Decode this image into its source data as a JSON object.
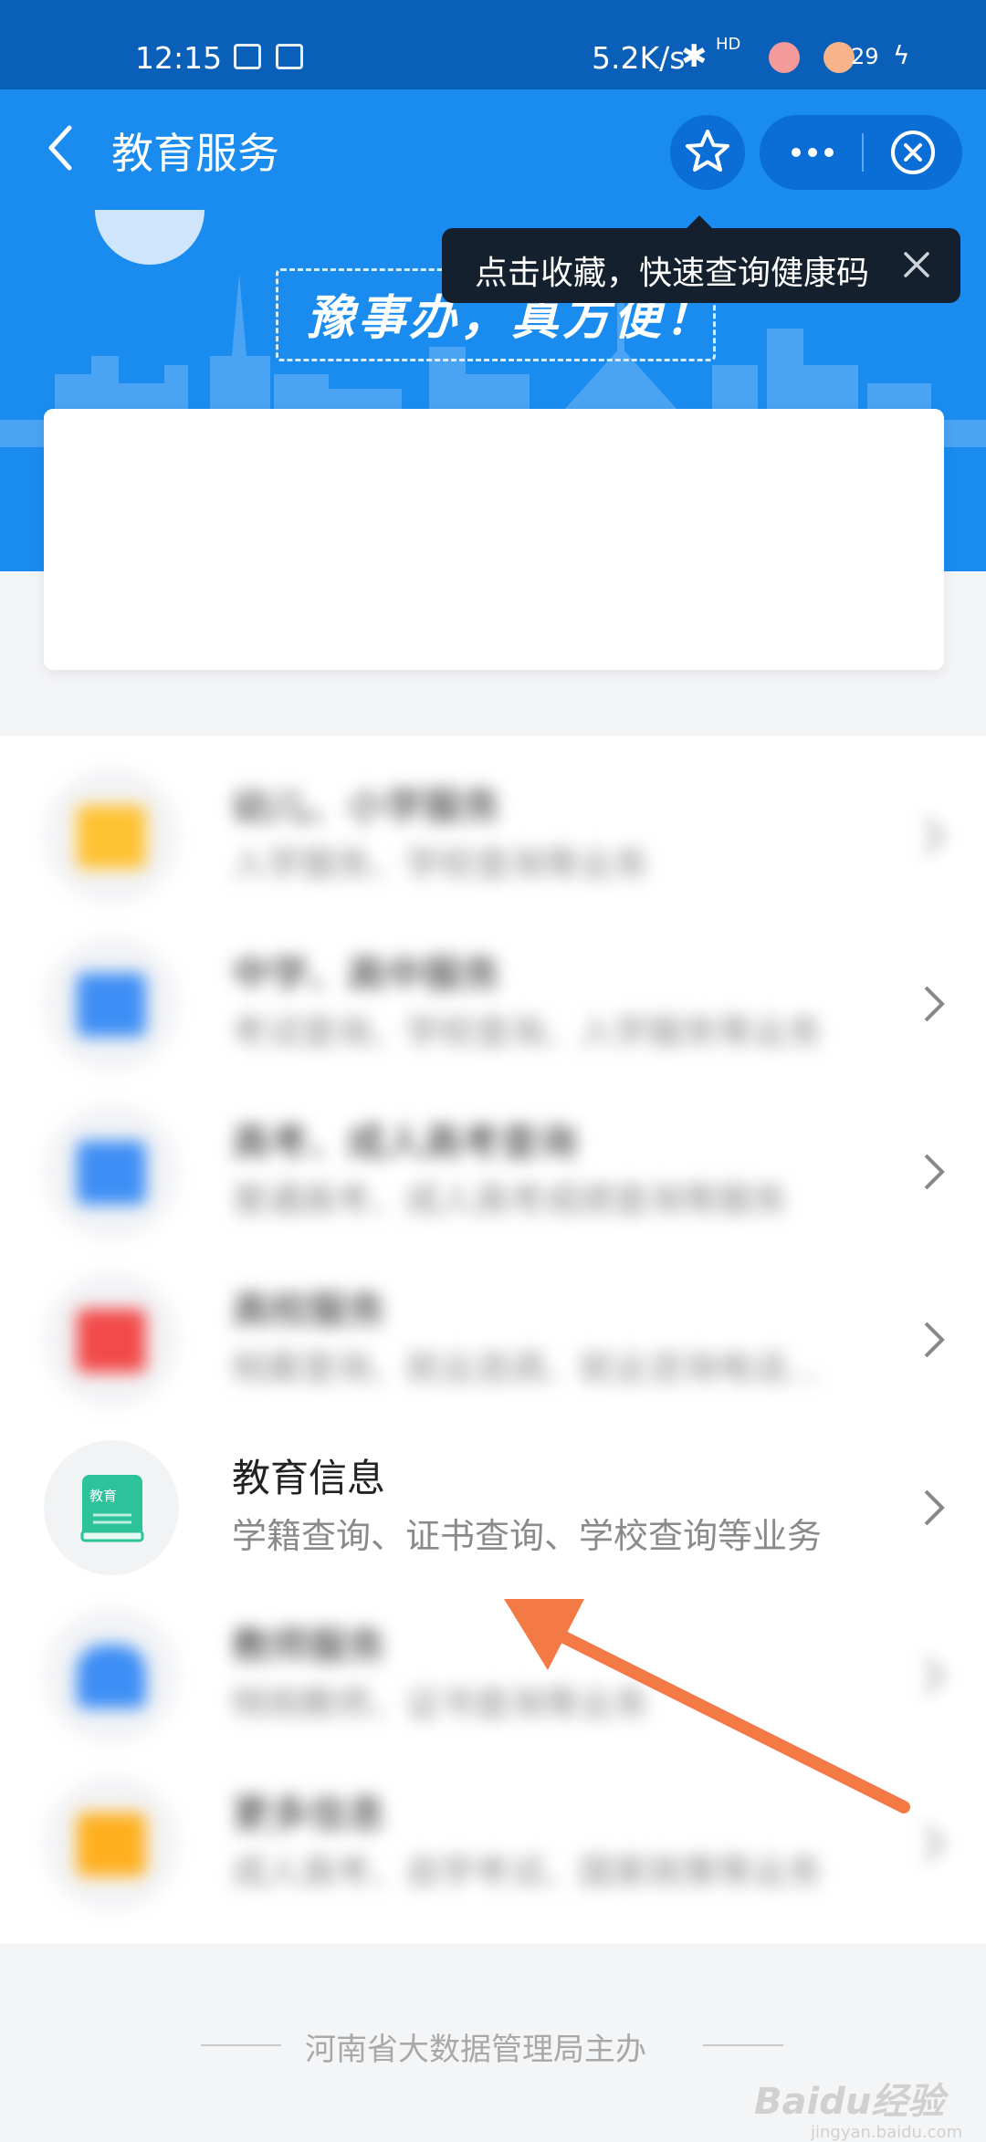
{
  "status_bar": {
    "time": "12:15",
    "net_speed": "5.2K/s",
    "bluetooth": "✱",
    "hd": "HD",
    "battery": "29",
    "charging": "ϟ"
  },
  "nav": {
    "title": "教育服务",
    "back_icon": "chevron-left-icon",
    "star_icon": "star-icon",
    "more_icon": "more-dots-icon",
    "close_icon": "close-circle-icon"
  },
  "banner": {
    "slogan": "豫事办，真方便！"
  },
  "tooltip": {
    "text": "点击收藏，快速查询健康码",
    "close_icon": "close-icon"
  },
  "list": {
    "items": [
      {
        "title": "幼儿、小学服务",
        "subtitle": "入学服务、学校查询等业务",
        "icon": "folder-icon",
        "color": "#ffc233",
        "blurred": true
      },
      {
        "title": "中学、高中服务",
        "subtitle": "考试查询、学校查询、入学服务等业务",
        "icon": "document-icon",
        "color": "#3d8ef5",
        "blurred": true
      },
      {
        "title": "高考、成人高考查询",
        "subtitle": "普通高考、成人高考成绩查询等服务",
        "icon": "exam-icon",
        "color": "#3d8ef5",
        "blurred": true
      },
      {
        "title": "高校服务",
        "subtitle": "档案查询、就业选调、就业咨询电话...",
        "icon": "graduation-cap-icon",
        "color": "#f24a4a",
        "blurred": true
      },
      {
        "title": "教育信息",
        "subtitle": "学籍查询、证书查询、学校查询等业务",
        "icon": "book-icon",
        "icon_label": "教育",
        "color": "#2cc39a",
        "blurred": false
      },
      {
        "title": "教师服务",
        "subtitle": "特岗教师、证书查询等业务",
        "icon": "teacher-icon",
        "color": "#3d8ef5",
        "blurred": true
      },
      {
        "title": "更多信息",
        "subtitle": "成人高考、自学考试、国家政策等业务",
        "icon": "grid-icon",
        "color": "#ffb01f",
        "blurred": true
      }
    ]
  },
  "footer": {
    "text": "河南省大数据管理局主办",
    "watermark": "Baidu经验",
    "watermark_sub": "jingyan.baidu.com"
  },
  "colors": {
    "nav_blue": "#1a8cf0",
    "status_blue": "#0a5fb8",
    "annotation_arrow": "#f47a45"
  }
}
